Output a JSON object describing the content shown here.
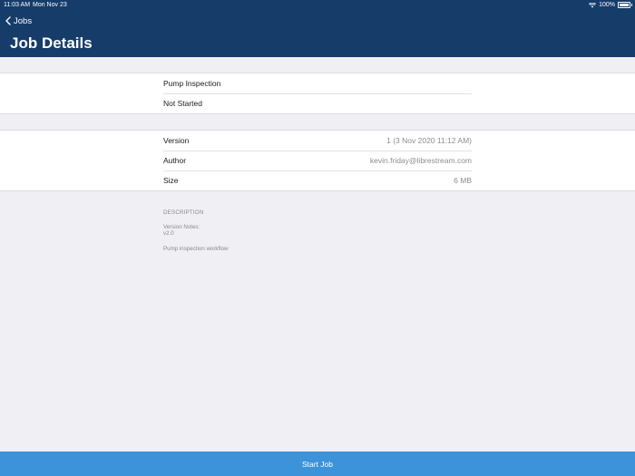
{
  "status_bar": {
    "time": "11:03 AM",
    "date": "Mon Nov 23",
    "battery": "100%"
  },
  "nav": {
    "back_label": "Jobs",
    "title": "Job Details"
  },
  "job": {
    "name": "Pump Inspection",
    "status": "Not Started"
  },
  "details": [
    {
      "label": "Version",
      "value": "1 (3 Nov 2020 11:12 AM)"
    },
    {
      "label": "Author",
      "value": "kevin.friday@librestream.com"
    },
    {
      "label": "Size",
      "value": "6 MB"
    }
  ],
  "description": {
    "heading": "DESCRIPTION",
    "notes_label": "Version Notes:",
    "notes_value": "v2.0",
    "text": "Pump inspection workflow"
  },
  "footer": {
    "start_button": "Start Job"
  },
  "colors": {
    "header": "#163c6a",
    "background": "#efeff4",
    "button": "#3c93d9"
  }
}
